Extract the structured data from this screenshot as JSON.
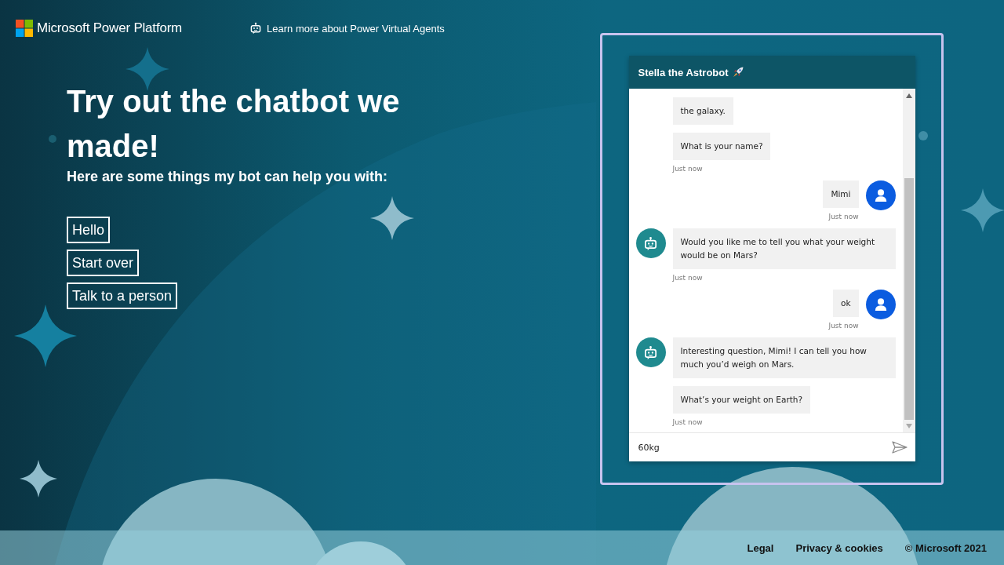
{
  "header": {
    "brand": "Microsoft Power Platform",
    "link": "Learn more about Power Virtual Agents"
  },
  "hero": {
    "title": "Try out the chatbot we made!",
    "subtitle": "Here are some things my bot can help you with:"
  },
  "suggestions": [
    "Hello",
    "Start over",
    "Talk to a person"
  ],
  "chat": {
    "title": "Stella the Astrobot",
    "messages": [
      {
        "kind": "bot",
        "avatar": false,
        "text": "the galaxy."
      },
      {
        "kind": "bot",
        "avatar": false,
        "text": "What is your name?",
        "time": "Just now"
      },
      {
        "kind": "user",
        "avatar": true,
        "text": "Mimi",
        "time": "Just now"
      },
      {
        "kind": "bot",
        "avatar": true,
        "text": "Would you like me to tell you what your weight would be on Mars?",
        "time": "Just now"
      },
      {
        "kind": "user",
        "avatar": true,
        "text": "ok",
        "time": "Just now"
      },
      {
        "kind": "bot",
        "avatar": true,
        "text": "Interesting question, Mimi! I can tell you how much you’d weigh on Mars."
      },
      {
        "kind": "bot",
        "avatar": false,
        "text": "What’s your weight on Earth?",
        "time": "Just now"
      }
    ],
    "input": {
      "value": "60kg"
    }
  },
  "footer": {
    "links": [
      "Legal",
      "Privacy & cookies"
    ],
    "copyright": "© Microsoft 2021"
  }
}
